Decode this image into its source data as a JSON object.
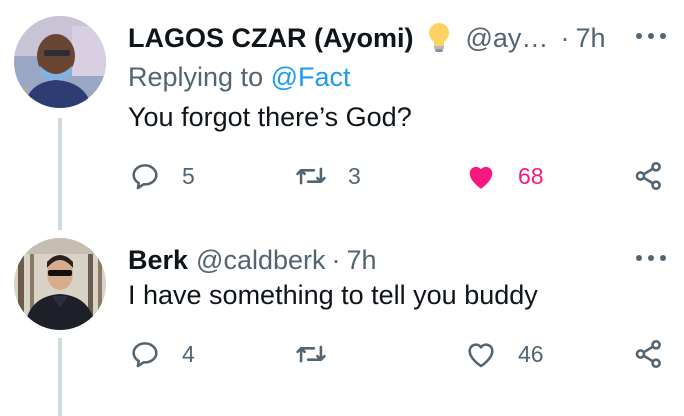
{
  "tweets": [
    {
      "name": "LAGOS CZAR (Ayomi)",
      "handle": "@ay…",
      "dot": "·",
      "time": "7h",
      "replying_prefix": "Replying to",
      "replying_handle": "@Fact",
      "text": "You forgot there’s God?",
      "replies": "5",
      "retweets": "3",
      "likes": "68",
      "liked": true
    },
    {
      "name": "Berk",
      "handle": "@caldberk",
      "dot": "·",
      "time": "7h",
      "text": "I have something to tell you buddy",
      "replies": "4",
      "retweets": "",
      "likes": "46",
      "liked": false
    }
  ],
  "colors": {
    "link": "#1d9bf0",
    "muted": "#536471",
    "like": "#f91880",
    "thread_line": "#cfd9de"
  },
  "icons": [
    "lightbulb-icon",
    "more-icon",
    "reply-icon",
    "retweet-icon",
    "heart-icon",
    "share-icon"
  ]
}
